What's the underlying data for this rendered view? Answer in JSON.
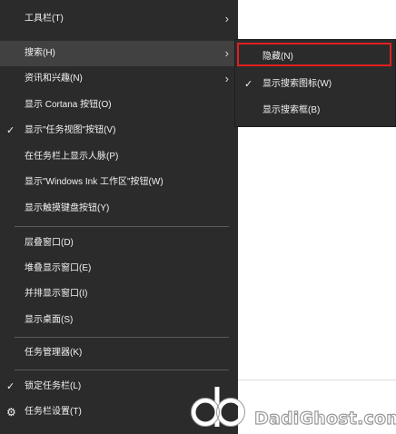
{
  "context_menu": {
    "items": [
      {
        "label": "工具栏(T)",
        "has_submenu": true,
        "checked": false
      },
      {
        "label": "搜索(H)",
        "has_submenu": true,
        "checked": false,
        "highlighted": true
      },
      {
        "label": "资讯和兴趣(N)",
        "has_submenu": true,
        "checked": false
      },
      {
        "label": "显示 Cortana 按钮(O)",
        "has_submenu": false,
        "checked": false
      },
      {
        "label": "显示\"任务视图\"按钮(V)",
        "has_submenu": false,
        "checked": true
      },
      {
        "label": "在任务栏上显示人脉(P)",
        "has_submenu": false,
        "checked": false
      },
      {
        "label": "显示\"Windows Ink 工作区\"按钮(W)",
        "has_submenu": false,
        "checked": false
      },
      {
        "label": "显示触摸键盘按钮(Y)",
        "has_submenu": false,
        "checked": false
      },
      {
        "label": "层叠窗口(D)",
        "has_submenu": false,
        "checked": false
      },
      {
        "label": "堆叠显示窗口(E)",
        "has_submenu": false,
        "checked": false
      },
      {
        "label": "并排显示窗口(I)",
        "has_submenu": false,
        "checked": false
      },
      {
        "label": "显示桌面(S)",
        "has_submenu": false,
        "checked": false
      },
      {
        "label": "任务管理器(K)",
        "has_submenu": false,
        "checked": false
      },
      {
        "label": "锁定任务栏(L)",
        "has_submenu": false,
        "checked": true
      },
      {
        "label": "任务栏设置(T)",
        "has_submenu": false,
        "checked": false,
        "icon": "gear-icon"
      }
    ]
  },
  "search_submenu": {
    "items": [
      {
        "label": "隐藏(N)",
        "checked": false,
        "outlined": true
      },
      {
        "label": "显示搜索图标(W)",
        "checked": true
      },
      {
        "label": "显示搜索框(B)",
        "checked": false
      }
    ]
  },
  "glyphs": {
    "check": "✓",
    "chevron": "›",
    "gear": "⚙"
  },
  "watermark": {
    "text": "DadiGhost.com",
    "logo": "dadighost-logo-icon"
  },
  "colors": {
    "menu_bg": "#2b2b2b",
    "menu_text": "#f2f2f2",
    "highlight_bg": "#414141",
    "separator": "#5a5a5a",
    "outline_red": "#e02020"
  }
}
